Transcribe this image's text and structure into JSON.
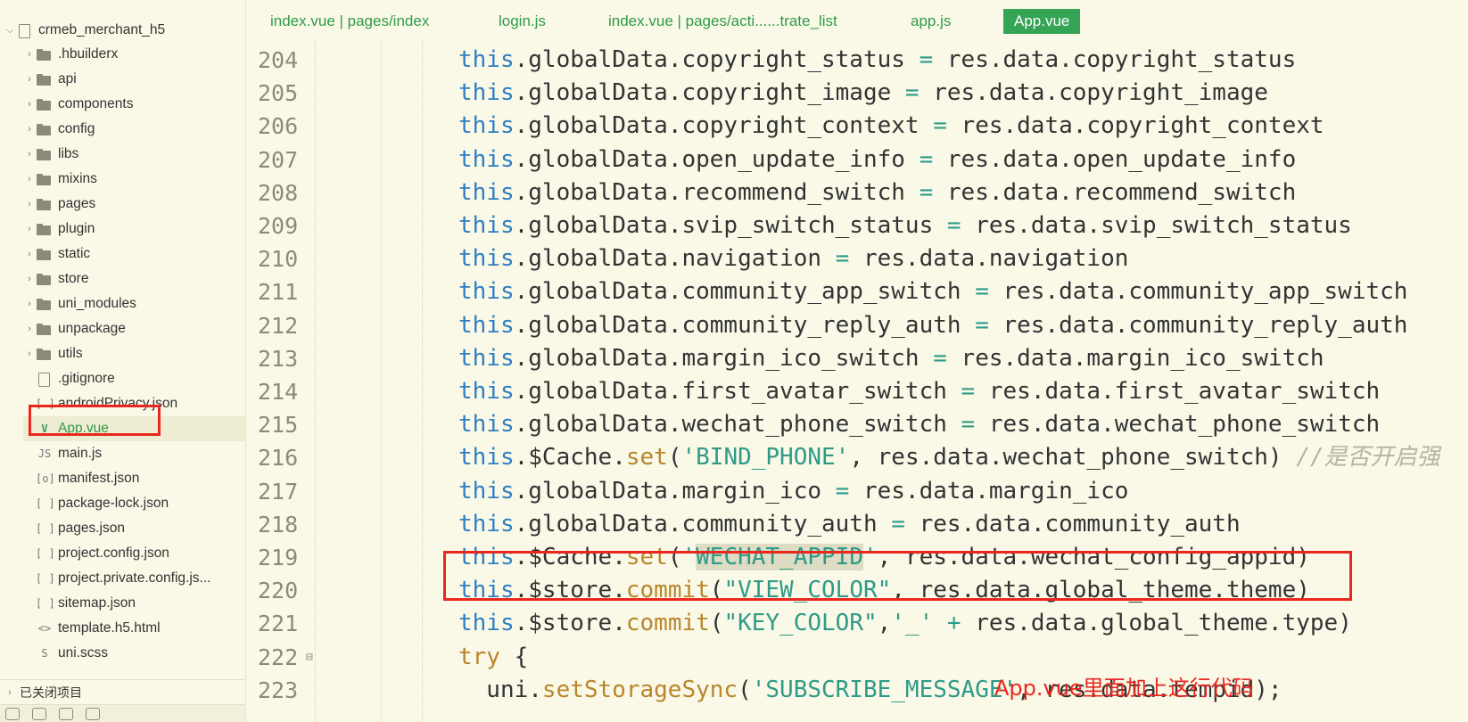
{
  "sidebar": {
    "root": "crmeb_merchant_h5",
    "items": [
      {
        "label": ".hbuilderx",
        "icon": "folder-icon",
        "expandable": true
      },
      {
        "label": "api",
        "icon": "folder-icon",
        "expandable": true
      },
      {
        "label": "components",
        "icon": "folder-icon",
        "expandable": true
      },
      {
        "label": "config",
        "icon": "folder-icon",
        "expandable": true
      },
      {
        "label": "libs",
        "icon": "folder-icon",
        "expandable": true
      },
      {
        "label": "mixins",
        "icon": "folder-icon",
        "expandable": true
      },
      {
        "label": "pages",
        "icon": "folder-icon",
        "expandable": true
      },
      {
        "label": "plugin",
        "icon": "folder-icon",
        "expandable": true
      },
      {
        "label": "static",
        "icon": "folder-icon",
        "expandable": true
      },
      {
        "label": "store",
        "icon": "folder-icon",
        "expandable": true
      },
      {
        "label": "uni_modules",
        "icon": "folder-icon",
        "expandable": true
      },
      {
        "label": "unpackage",
        "icon": "folder-icon",
        "expandable": true
      },
      {
        "label": "utils",
        "icon": "folder-icon",
        "expandable": true
      },
      {
        "label": ".gitignore",
        "icon": "file-icon",
        "expandable": false
      },
      {
        "label": "androidPrivacy.json",
        "icon": "json-icon",
        "expandable": false
      },
      {
        "label": "App.vue",
        "icon": "vue-icon",
        "expandable": false,
        "selected": true
      },
      {
        "label": "main.js",
        "icon": "js-icon",
        "expandable": false
      },
      {
        "label": "manifest.json",
        "icon": "gear-icon",
        "expandable": false
      },
      {
        "label": "package-lock.json",
        "icon": "json-icon",
        "expandable": false
      },
      {
        "label": "pages.json",
        "icon": "json-icon",
        "expandable": false
      },
      {
        "label": "project.config.json",
        "icon": "json-icon",
        "expandable": false
      },
      {
        "label": "project.private.config.js...",
        "icon": "json-icon",
        "expandable": false
      },
      {
        "label": "sitemap.json",
        "icon": "json-icon",
        "expandable": false
      },
      {
        "label": "template.h5.html",
        "icon": "code-icon",
        "expandable": false
      },
      {
        "label": "uni.scss",
        "icon": "scss-icon",
        "expandable": false
      }
    ],
    "closed_projects": "已关闭项目"
  },
  "tabs": [
    {
      "label": "index.vue | pages/index",
      "active": false
    },
    {
      "label": "login.js",
      "active": false
    },
    {
      "label": "index.vue | pages/acti......trate_list",
      "active": false
    },
    {
      "label": "app.js",
      "active": false
    },
    {
      "label": "App.vue",
      "active": true
    }
  ],
  "editor": {
    "lines": [
      {
        "n": "204",
        "tokens": [
          [
            "kw",
            "this"
          ],
          [
            "",
            "."
          ],
          [
            "",
            "globalData.copyright_status "
          ],
          [
            "op",
            "="
          ],
          [
            "",
            " res.data.copyright_status"
          ]
        ]
      },
      {
        "n": "205",
        "tokens": [
          [
            "kw",
            "this"
          ],
          [
            "",
            "."
          ],
          [
            "",
            "globalData.copyright_image "
          ],
          [
            "op",
            "="
          ],
          [
            "",
            " res.data.copyright_image"
          ]
        ]
      },
      {
        "n": "206",
        "tokens": [
          [
            "kw",
            "this"
          ],
          [
            "",
            "."
          ],
          [
            "",
            "globalData.copyright_context "
          ],
          [
            "op",
            "="
          ],
          [
            "",
            " res.data.copyright_context"
          ]
        ]
      },
      {
        "n": "207",
        "tokens": [
          [
            "kw",
            "this"
          ],
          [
            "",
            "."
          ],
          [
            "",
            "globalData.open_update_info "
          ],
          [
            "op",
            "="
          ],
          [
            "",
            " res.data.open_update_info"
          ]
        ]
      },
      {
        "n": "208",
        "tokens": [
          [
            "kw",
            "this"
          ],
          [
            "",
            "."
          ],
          [
            "",
            "globalData.recommend_switch "
          ],
          [
            "op",
            "="
          ],
          [
            "",
            " res.data.recommend_switch"
          ]
        ]
      },
      {
        "n": "209",
        "tokens": [
          [
            "kw",
            "this"
          ],
          [
            "",
            "."
          ],
          [
            "",
            "globalData.svip_switch_status "
          ],
          [
            "op",
            "="
          ],
          [
            "",
            " res.data.svip_switch_status"
          ]
        ]
      },
      {
        "n": "210",
        "tokens": [
          [
            "kw",
            "this"
          ],
          [
            "",
            "."
          ],
          [
            "",
            "globalData.navigation "
          ],
          [
            "op",
            "="
          ],
          [
            "",
            " res.data.navigation"
          ]
        ]
      },
      {
        "n": "211",
        "tokens": [
          [
            "kw",
            "this"
          ],
          [
            "",
            "."
          ],
          [
            "",
            "globalData.community_app_switch "
          ],
          [
            "op",
            "="
          ],
          [
            "",
            " res.data.community_app_switch"
          ]
        ]
      },
      {
        "n": "212",
        "tokens": [
          [
            "kw",
            "this"
          ],
          [
            "",
            "."
          ],
          [
            "",
            "globalData.community_reply_auth "
          ],
          [
            "op",
            "="
          ],
          [
            "",
            " res.data.community_reply_auth"
          ]
        ]
      },
      {
        "n": "213",
        "tokens": [
          [
            "kw",
            "this"
          ],
          [
            "",
            "."
          ],
          [
            "",
            "globalData.margin_ico_switch "
          ],
          [
            "op",
            "="
          ],
          [
            "",
            " res.data.margin_ico_switch"
          ]
        ]
      },
      {
        "n": "214",
        "tokens": [
          [
            "kw",
            "this"
          ],
          [
            "",
            "."
          ],
          [
            "",
            "globalData.first_avatar_switch "
          ],
          [
            "op",
            "="
          ],
          [
            "",
            " res.data.first_avatar_switch"
          ]
        ]
      },
      {
        "n": "215",
        "tokens": [
          [
            "kw",
            "this"
          ],
          [
            "",
            "."
          ],
          [
            "",
            "globalData.wechat_phone_switch "
          ],
          [
            "op",
            "="
          ],
          [
            "",
            " res.data.wechat_phone_switch"
          ]
        ]
      },
      {
        "n": "216",
        "tokens": [
          [
            "kw",
            "this"
          ],
          [
            "",
            "."
          ],
          [
            "",
            "$Cache."
          ],
          [
            "fn",
            "set"
          ],
          [
            "",
            "("
          ],
          [
            "str",
            "'BIND_PHONE'"
          ],
          [
            "",
            ", res.data.wechat_phone_switch) "
          ],
          [
            "cm",
            "//是否开启强"
          ]
        ]
      },
      {
        "n": "217",
        "tokens": [
          [
            "kw",
            "this"
          ],
          [
            "",
            "."
          ],
          [
            "",
            "globalData.margin_ico "
          ],
          [
            "op",
            "="
          ],
          [
            "",
            " res.data.margin_ico"
          ]
        ]
      },
      {
        "n": "218",
        "tokens": [
          [
            "kw",
            "this"
          ],
          [
            "",
            "."
          ],
          [
            "",
            "globalData.community_auth "
          ],
          [
            "op",
            "="
          ],
          [
            "",
            " res.data.community_auth"
          ]
        ]
      },
      {
        "n": "219",
        "tokens": [
          [
            "kw",
            "this"
          ],
          [
            "",
            "."
          ],
          [
            "",
            "$Cache."
          ],
          [
            "fn",
            "set"
          ],
          [
            "",
            "("
          ],
          [
            "str",
            "'"
          ],
          [
            "str hl",
            "WECHAT_APPID"
          ],
          [
            "str",
            "'"
          ],
          [
            "",
            ", res.data.wechat_config_appid)"
          ]
        ]
      },
      {
        "n": "220",
        "tokens": [
          [
            "kw",
            "this"
          ],
          [
            "",
            "."
          ],
          [
            "",
            "$store."
          ],
          [
            "fn",
            "commit"
          ],
          [
            "",
            "("
          ],
          [
            "str",
            "\"VIEW_COLOR\""
          ],
          [
            "",
            ", res.data.global_theme.theme)"
          ]
        ]
      },
      {
        "n": "221",
        "tokens": [
          [
            "kw",
            "this"
          ],
          [
            "",
            "."
          ],
          [
            "",
            "$store."
          ],
          [
            "fn",
            "commit"
          ],
          [
            "",
            "("
          ],
          [
            "str",
            "\"KEY_COLOR\""
          ],
          [
            "",
            ","
          ],
          [
            "str",
            "'_'"
          ],
          [
            "",
            " "
          ],
          [
            "op",
            "+"
          ],
          [
            "",
            " res.data.global_theme.type)"
          ]
        ]
      },
      {
        "n": "222",
        "tokens": [
          [
            "fn",
            "try"
          ],
          [
            "",
            " {"
          ]
        ]
      },
      {
        "n": "223",
        "tokens": [
          [
            "",
            ""
          ],
          [
            "",
            "  uni."
          ],
          [
            "fn",
            "setStorageSync"
          ],
          [
            "",
            "("
          ],
          [
            "str",
            "'SUBSCRIBE_MESSAGE'"
          ],
          [
            "",
            ", res.data.tempid);"
          ]
        ]
      }
    ]
  },
  "annotation": "App.vue里面加上这行代码",
  "colors": {
    "accent": "#35a455",
    "highlight_box": "#e8281f",
    "keyword": "#2f7fc1",
    "string": "#2e9b88",
    "function": "#b8862b"
  }
}
